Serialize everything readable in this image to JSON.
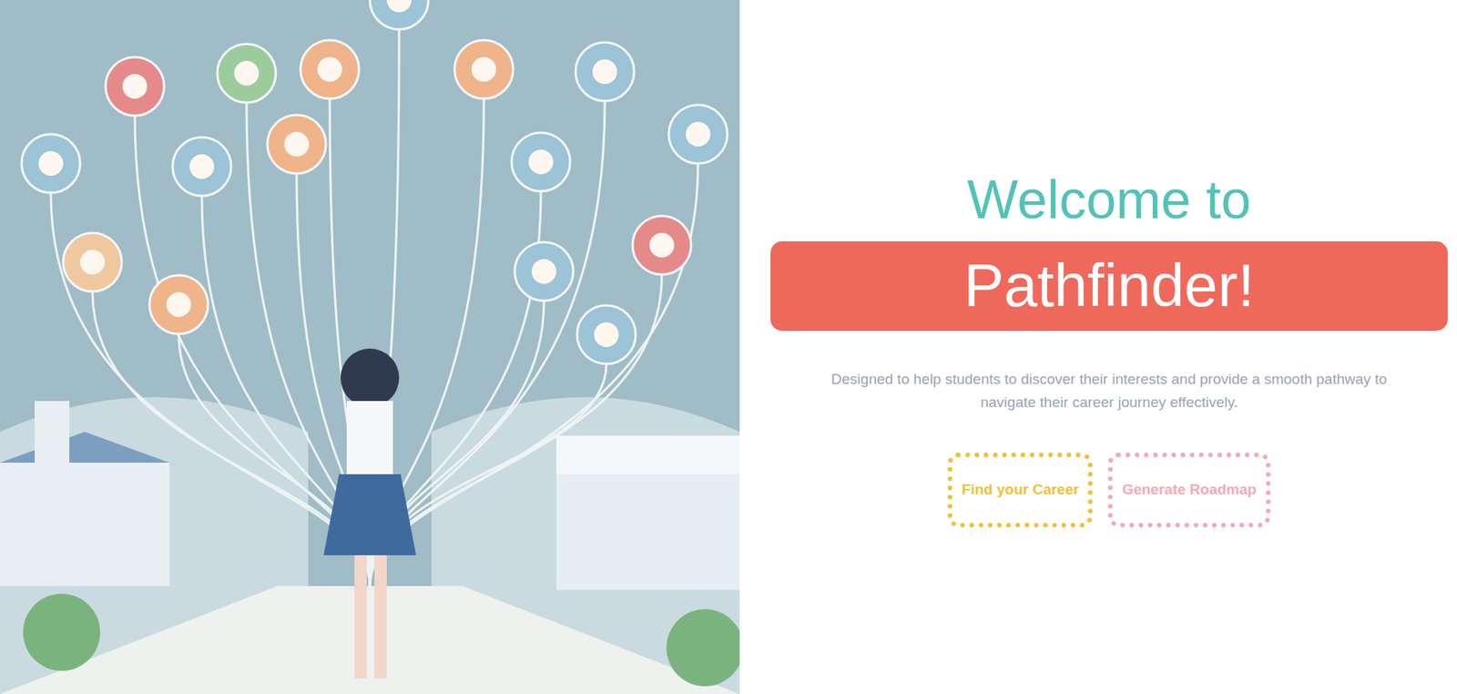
{
  "hero": {
    "title": "Welcome to",
    "brand": "Pathfinder!",
    "description": "Designed to help students to discover their interests and provide a smooth pathway to navigate their career journey effectively."
  },
  "buttons": [
    {
      "label": "Find your Career",
      "color": "#f2c037"
    },
    {
      "label": "Generate Roadmap",
      "color": "#f5a9b8"
    }
  ]
}
